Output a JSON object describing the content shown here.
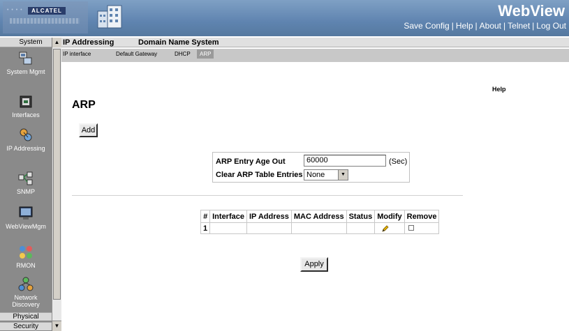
{
  "banner": {
    "logo_brand": "ALCATEL",
    "title": "WebView",
    "links": [
      "Save Config",
      "Help",
      "About",
      "Telnet",
      "Log Out"
    ]
  },
  "sidebar": {
    "header": "System",
    "items": [
      {
        "label": "System Mgmt",
        "icon": "system-mgmt-icon"
      },
      {
        "label": "Interfaces",
        "icon": "interfaces-icon"
      },
      {
        "label": "IP Addressing",
        "icon": "ip-addressing-icon"
      },
      {
        "label": "SNMP",
        "icon": "snmp-icon"
      },
      {
        "label": "WebViewMgm",
        "icon": "webview-mgmt-icon"
      },
      {
        "label": "RMON",
        "icon": "rmon-icon"
      },
      {
        "label": "Network Discovery",
        "icon": "network-discovery-icon"
      }
    ],
    "bottom_items": [
      "Physical",
      "Security"
    ]
  },
  "tabs": {
    "main": [
      "IP Addressing",
      "Domain Name System"
    ],
    "sub": [
      "IP interface",
      "Default Gateway",
      "DHCP",
      "ARP"
    ],
    "active_sub": "ARP"
  },
  "content": {
    "help": "Help",
    "title": "ARP",
    "add_label": "Add",
    "apply_label": "Apply",
    "form": {
      "age_out_label": "ARP Entry Age Out",
      "age_out_value": "60000",
      "age_out_unit": "(Sec)",
      "clear_label": "Clear ARP Table Entries",
      "clear_value": "None"
    },
    "table": {
      "headers": [
        "#",
        "Interface",
        "IP Address",
        "MAC Address",
        "Status",
        "Modify",
        "Remove"
      ],
      "rows": [
        {
          "index": "1",
          "interface": "",
          "ip": "",
          "mac": "",
          "status": ""
        }
      ]
    }
  }
}
